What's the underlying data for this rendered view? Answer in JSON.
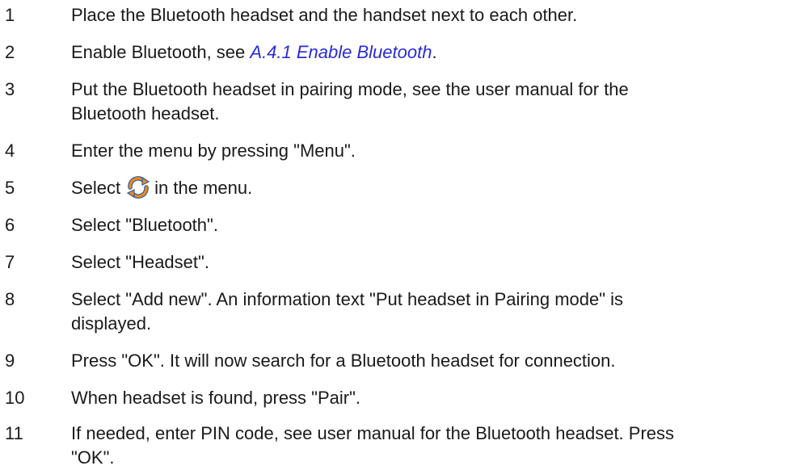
{
  "steps": [
    {
      "num": "1",
      "text": "Place the Bluetooth headset and the handset next to each other."
    },
    {
      "num": "2",
      "before": "Enable Bluetooth, see ",
      "link": "A.4.1 Enable Bluetooth",
      "after": "."
    },
    {
      "num": "3",
      "line1": "Put the Bluetooth headset in pairing mode, see the user manual for the",
      "line2": "Bluetooth headset."
    },
    {
      "num": "4",
      "text": "Enter the menu by pressing \"Menu\"."
    },
    {
      "num": "5",
      "before": "Select",
      "after": "in the menu.",
      "icon": "settings-sync-icon"
    },
    {
      "num": "6",
      "text": "Select \"Bluetooth\"."
    },
    {
      "num": "7",
      "text": "Select \"Headset\"."
    },
    {
      "num": "8",
      "line1": "Select \"Add new\". An information text \"Put headset in Pairing mode\" is",
      "line2": "displayed."
    },
    {
      "num": "9",
      "text": "Press \"OK\". It will now search for a Bluetooth headset for connection."
    },
    {
      "num": "10",
      "text": "When headset is found, press \"Pair\"."
    },
    {
      "num": "11",
      "line1": "If needed, enter PIN code, see user manual for the Bluetooth headset. Press",
      "line2": "\"OK\"."
    }
  ],
  "colors": {
    "link": "#2a2ad8",
    "text": "#1a1a1a",
    "icon_orange": "#f08a1c",
    "icon_blue": "#2c5aa0"
  }
}
